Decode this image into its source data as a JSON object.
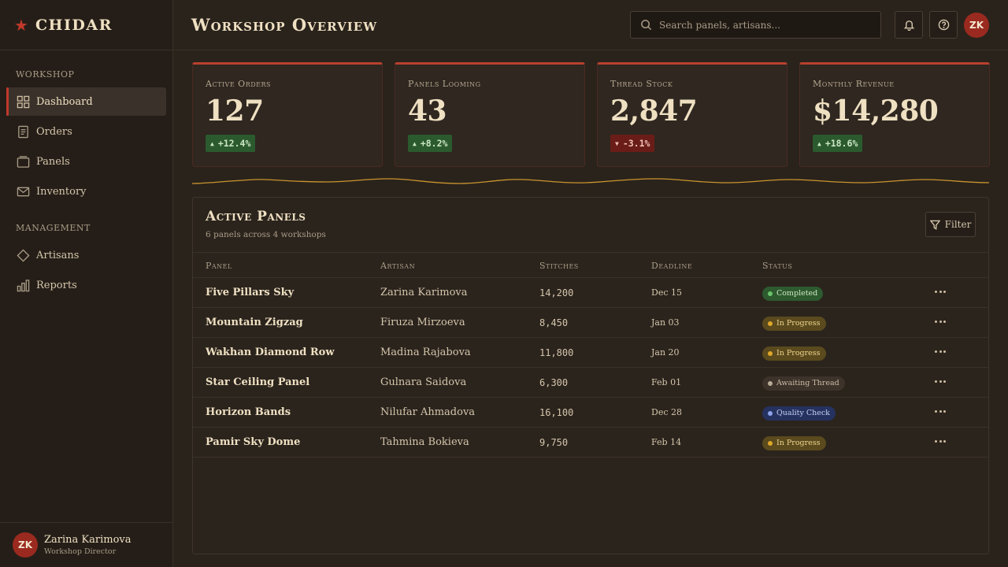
{
  "brand": {
    "name": "CHIDAR",
    "icon": "star-icon"
  },
  "sidebar": {
    "sections": [
      {
        "title": "WORKSHOP",
        "items": [
          {
            "label": "Dashboard",
            "icon": "grid-icon",
            "active": true
          },
          {
            "label": "Orders",
            "icon": "document-icon"
          },
          {
            "label": "Panels",
            "icon": "folder-icon"
          },
          {
            "label": "Inventory",
            "icon": "mail-icon"
          }
        ]
      },
      {
        "title": "MANAGEMENT",
        "items": [
          {
            "label": "Artisans",
            "icon": "diamond-icon"
          },
          {
            "label": "Reports",
            "icon": "bar-chart-icon"
          }
        ]
      }
    ],
    "user": {
      "initials": "ZK",
      "name": "Zarina Karimova",
      "role": "Workshop Director"
    }
  },
  "header": {
    "title": "Workshop Overview",
    "search_placeholder": "Search panels, artisans...",
    "avatar_initials": "ZK"
  },
  "stats": [
    {
      "label": "Active Orders",
      "value": "127",
      "delta": "+12.4%",
      "direction": "up"
    },
    {
      "label": "Panels Looming",
      "value": "43",
      "delta": "+8.2%",
      "direction": "up"
    },
    {
      "label": "Thread Stock",
      "value": "2,847",
      "delta": "-3.1%",
      "direction": "down"
    },
    {
      "label": "Monthly Revenue",
      "value": "$14,280",
      "delta": "+18.6%",
      "direction": "up"
    }
  ],
  "table": {
    "title": "Active Panels",
    "subtitle": "6 panels across 4 workshops",
    "filter_label": "Filter",
    "columns": [
      "Panel",
      "Artisan",
      "Stitches",
      "Deadline",
      "Status"
    ],
    "rows": [
      {
        "panel": "Five Pillars Sky",
        "artisan": "Zarina Karimova",
        "stitches": "14,200",
        "deadline": "Dec 15",
        "status": "Completed"
      },
      {
        "panel": "Mountain Zigzag",
        "artisan": "Firuza Mirzoeva",
        "stitches": "8,450",
        "deadline": "Jan 03",
        "status": "In Progress"
      },
      {
        "panel": "Wakhan Diamond Row",
        "artisan": "Madina Rajabova",
        "stitches": "11,800",
        "deadline": "Jan 20",
        "status": "In Progress"
      },
      {
        "panel": "Star Ceiling Panel",
        "artisan": "Gulnara Saidova",
        "stitches": "6,300",
        "deadline": "Feb 01",
        "status": "Awaiting Thread"
      },
      {
        "panel": "Horizon Bands",
        "artisan": "Nilufar Ahmadova",
        "stitches": "16,100",
        "deadline": "Dec 28",
        "status": "Quality Check"
      },
      {
        "panel": "Pamir Sky Dome",
        "artisan": "Tahmina Bokieva",
        "stitches": "9,750",
        "deadline": "Feb 14",
        "status": "In Progress"
      }
    ]
  },
  "status_colors": {
    "Completed": {
      "bg": "#2d5a2f",
      "fg": "#cfe6c6",
      "dot": "#6cc36b"
    },
    "In Progress": {
      "bg": "#5a4a1d",
      "fg": "#f0d58f",
      "dot": "#e0a72a"
    },
    "Awaiting Thread": {
      "bg": "#3d332b",
      "fg": "#cbbca3",
      "dot": "#b8ab97"
    },
    "Quality Check": {
      "bg": "#253260",
      "fg": "#c6d0f2",
      "dot": "#8ea4e8"
    }
  },
  "colors": {
    "accent": "#c0392b",
    "background": "#2a231c",
    "gold_line": "#c9942e"
  }
}
